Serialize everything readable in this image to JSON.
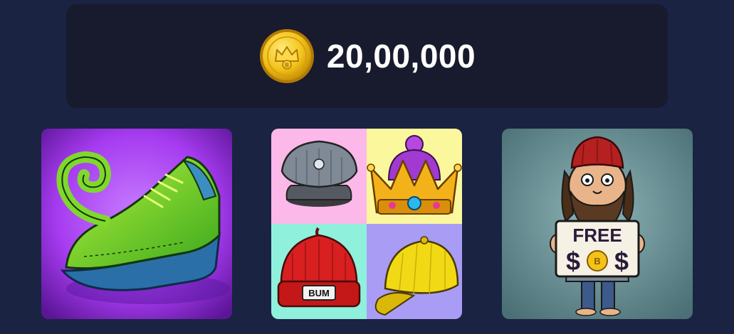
{
  "balance": {
    "coin_icon": "gold-coin-crown-icon",
    "amount": "20,00,000"
  },
  "cards": [
    {
      "id": "shoe",
      "icon": "curly-green-shoe-image"
    },
    {
      "id": "hats",
      "icon": "hat-collection-image",
      "hat_label": "BUM"
    },
    {
      "id": "bum",
      "icon": "bum-character-image",
      "sign_text": "FREE",
      "sign_symbols": "$B$"
    }
  ],
  "colors": {
    "background": "#1a2342",
    "panel": "#181b2e",
    "coin": "#f2c41a",
    "shoe_bg": "#a63bf0",
    "bum_bg": "#5f8a8f"
  }
}
